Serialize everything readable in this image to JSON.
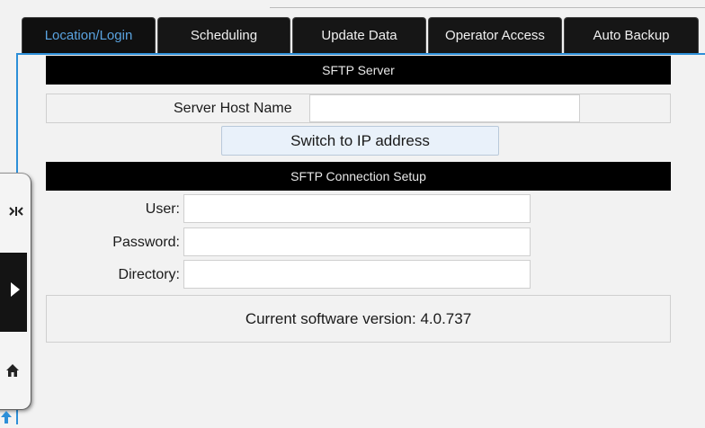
{
  "tabs": [
    {
      "label": "Location/Login",
      "active": true
    },
    {
      "label": "Scheduling",
      "active": false
    },
    {
      "label": "Update Data",
      "active": false
    },
    {
      "label": "Operator Access",
      "active": false
    },
    {
      "label": "Auto Backup",
      "active": false
    }
  ],
  "sftp_server": {
    "header": "SFTP Server",
    "host_label": "Server Host Name",
    "host_value": "",
    "switch_button": "Switch to IP address"
  },
  "connection_setup": {
    "header": "SFTP Connection Setup",
    "user_label": "User:",
    "user_value": "",
    "password_label": "Password:",
    "password_value": "",
    "directory_label": "Directory:",
    "directory_value": ""
  },
  "version_text": "Current software version: 4.0.737",
  "colors": {
    "accent": "#2d8fd8",
    "active_tab_text": "#5aa3e0",
    "tab_bg": "#161616",
    "header_bar": "#000000",
    "page_bg": "#f2f2f2"
  },
  "icons": {
    "drawer_top": "drawer-handle-icon",
    "drawer_middle": "play-arrow-icon",
    "drawer_bottom": "home-icon",
    "bottom_left": "arrow-up-icon"
  }
}
